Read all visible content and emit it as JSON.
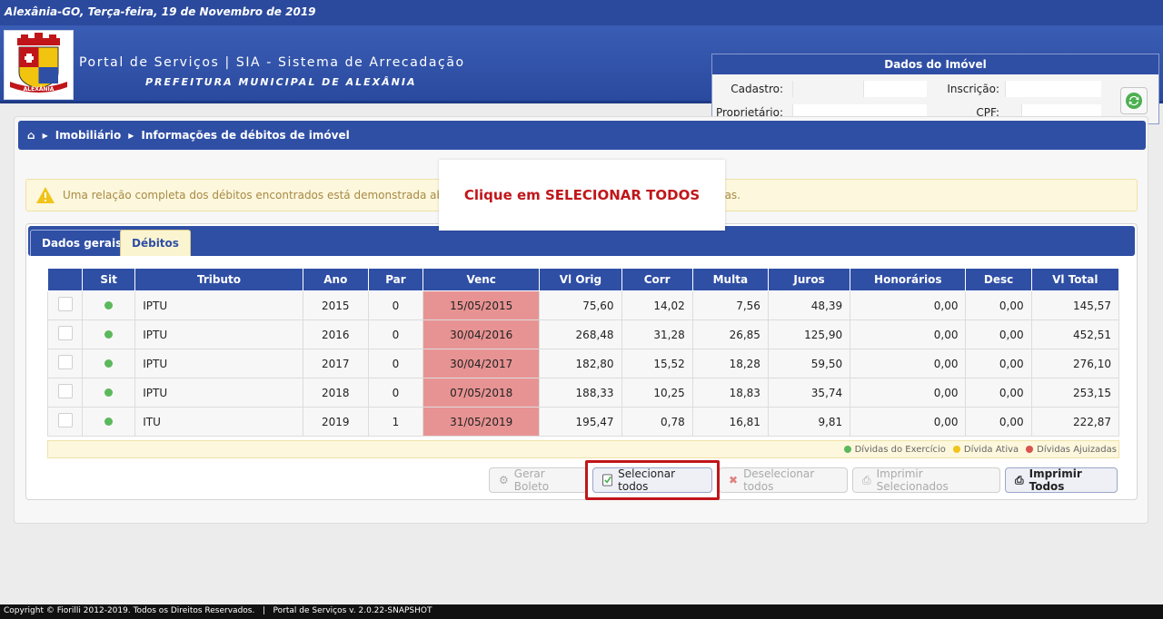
{
  "topbar": {
    "date_text": "Alexânia-GO, Terça-feira, 19 de Novembro de 2019"
  },
  "header": {
    "title": "Portal de Serviços | SIA - Sistema de Arrecadação",
    "subtitle": "PREFEITURA MUNICIPAL DE ALEXÂNIA",
    "logo_text": "ALEXÂNIA"
  },
  "imovel": {
    "heading": "Dados do Imóvel",
    "cadastro_label": "Cadastro:",
    "inscricao_label": "Inscrição:",
    "proprietario_label": "Proprietário:",
    "cpf_label": "CPF:"
  },
  "breadcrumb": {
    "item1": "Imobiliário",
    "item2": "Informações de débitos de imóvel"
  },
  "alert": {
    "text_start": "Uma relação completa dos débitos encontrados está demonstrada abaixo. Voc",
    "text_end": "las."
  },
  "tooltip": {
    "text": "Clique em SELECIONAR TODOS"
  },
  "tabs": [
    {
      "label": "Dados gerais"
    },
    {
      "label": "Débitos"
    }
  ],
  "table": {
    "headers": [
      "",
      "Sit",
      "Tributo",
      "Ano",
      "Par",
      "Venc",
      "Vl Orig",
      "Corr",
      "Multa",
      "Juros",
      "Honorários",
      "Desc",
      "Vl Total"
    ],
    "rows": [
      [
        "IPTU",
        "2015",
        "0",
        "15/05/2015",
        "75,60",
        "14,02",
        "7,56",
        "48,39",
        "0,00",
        "0,00",
        "145,57"
      ],
      [
        "IPTU",
        "2016",
        "0",
        "30/04/2016",
        "268,48",
        "31,28",
        "26,85",
        "125,90",
        "0,00",
        "0,00",
        "452,51"
      ],
      [
        "IPTU",
        "2017",
        "0",
        "30/04/2017",
        "182,80",
        "15,52",
        "18,28",
        "59,50",
        "0,00",
        "0,00",
        "276,10"
      ],
      [
        "IPTU",
        "2018",
        "0",
        "07/05/2018",
        "188,33",
        "10,25",
        "18,83",
        "35,74",
        "0,00",
        "0,00",
        "253,15"
      ],
      [
        "ITU",
        "2019",
        "1",
        "31/05/2019",
        "195,47",
        "0,78",
        "16,81",
        "9,81",
        "0,00",
        "0,00",
        "222,87"
      ]
    ]
  },
  "legend": {
    "exercicio": "Dívidas do Exercício",
    "ativa": "Dívida Ativa",
    "ajuizadas": "Dívidas Ajuizadas"
  },
  "buttons": {
    "gerar_boleto": "Gerar Boleto",
    "selecionar_todos": "Selecionar todos",
    "deselecionar_todos": "Deselecionar todos",
    "imprimir_selecionados": "Imprimir Selecionados",
    "imprimir_todos": "Imprimir Todos"
  },
  "footer": {
    "text": "Copyright © Fiorilli 2012-2019. Todos os Direitos Reservados.   |   Portal de Serviços v. 2.0.22-SNAPSHOT"
  },
  "colors": {
    "primary_blue": "#2f4fa5",
    "status_green": "#5cb85c",
    "status_yellow": "#f0c419",
    "status_red": "#d9534f",
    "venc_overdue": "#e89393",
    "highlight_red": "#c0161a"
  }
}
